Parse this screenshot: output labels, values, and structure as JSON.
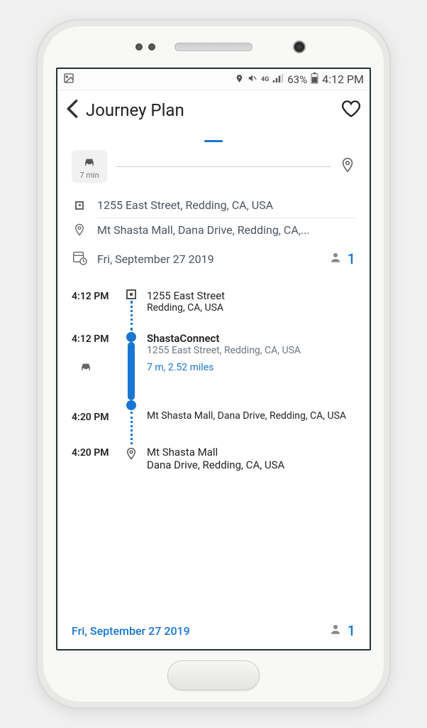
{
  "status_bar": {
    "battery_pct": "63%",
    "time": "4:12 PM",
    "network_label": "4G",
    "carrier_icon": "lte-icon"
  },
  "header": {
    "title": "Journey Plan"
  },
  "summary": {
    "mode_duration": "7 min",
    "origin": "1255 East Street, Redding, CA, USA",
    "destination": "Mt Shasta Mall, Dana Drive, Redding, CA,...",
    "date": "Fri, September 27 2019",
    "passengers": "1"
  },
  "itinerary": {
    "steps": [
      {
        "time": "4:12 PM",
        "title": "1255 East Street",
        "subtitle": "Redding,  CA,  USA",
        "node": "square"
      },
      {
        "time": "4:12 PM",
        "title": "ShastaConnect",
        "subtitle": "1255 East Street, Redding, CA, USA",
        "meta": "7 m, 2.52 miles",
        "node": "bullet-start",
        "mode_icon": "car-icon"
      },
      {
        "time": "4:20 PM",
        "title": "Mt Shasta Mall, Dana Drive, Redding, CA, USA",
        "subtitle": "",
        "node": "bullet-end"
      },
      {
        "time": "4:20 PM",
        "title": "Mt Shasta Mall",
        "subtitle": "Dana Drive,  Redding,  CA,  USA",
        "node": "pin"
      }
    ]
  },
  "footer": {
    "date": "Fri, September 27 2019",
    "passengers": "1"
  },
  "colors": {
    "accent": "#1976d2",
    "text_muted": "#4a5560"
  }
}
